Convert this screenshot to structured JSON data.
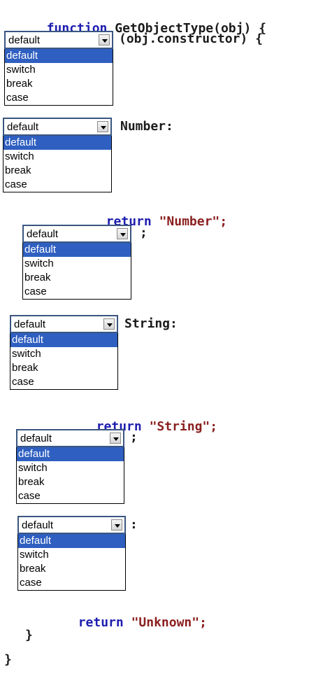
{
  "lines": {
    "fn_kw": "function",
    "fn_sig": "GetObjectType(obj) {",
    "switch_tail": "(obj.constructor) {",
    "case1_tail": "Number:",
    "ret_kw1": "return",
    "ret_val1": "\"Number\";",
    "sep1": ";",
    "case2_tail": "String:",
    "ret_kw2": "return",
    "ret_val2": "\"String\";",
    "sep2": ";",
    "colon3": ":",
    "ret_kw3": "return",
    "ret_val3": "\"Unknown\";",
    "close_inner": "}",
    "close_outer": "}"
  },
  "dropdown": {
    "selected": "default",
    "options": [
      "default",
      "switch",
      "break",
      "case"
    ]
  },
  "colors": {
    "keyword": "#1d1db0",
    "string": "#8b1f1f",
    "selection": "#2f5fc0"
  }
}
